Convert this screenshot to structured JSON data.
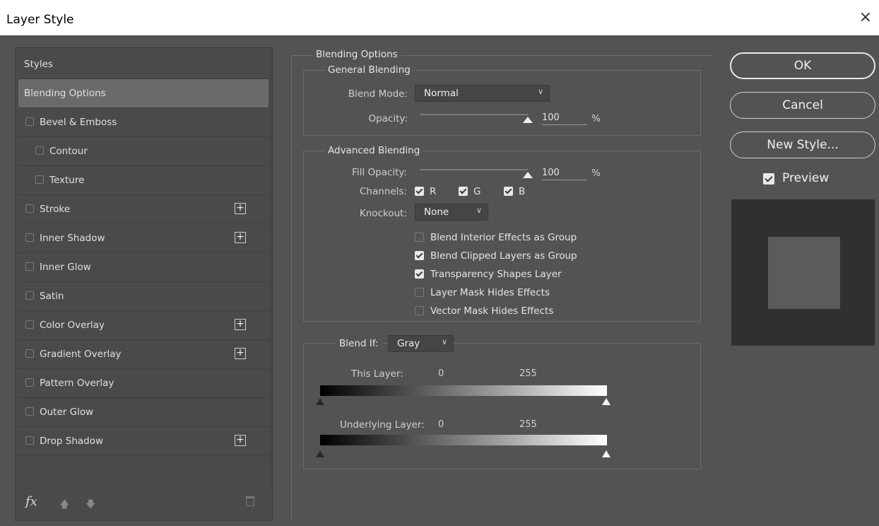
{
  "window": {
    "title": "Layer Style",
    "close_glyph": "×"
  },
  "sidebar": {
    "items": [
      {
        "label": "Styles",
        "checkbox": false,
        "plus": false,
        "selected": false,
        "indent": 0
      },
      {
        "label": "Blending Options",
        "checkbox": false,
        "plus": false,
        "selected": true,
        "indent": 0
      },
      {
        "label": "Bevel & Emboss",
        "checkbox": true,
        "checked": false,
        "plus": false,
        "selected": false,
        "indent": 0
      },
      {
        "label": "Contour",
        "checkbox": true,
        "checked": false,
        "plus": false,
        "selected": false,
        "indent": 1
      },
      {
        "label": "Texture",
        "checkbox": true,
        "checked": false,
        "plus": false,
        "selected": false,
        "indent": 1
      },
      {
        "label": "Stroke",
        "checkbox": true,
        "checked": false,
        "plus": true,
        "selected": false,
        "indent": 0
      },
      {
        "label": "Inner Shadow",
        "checkbox": true,
        "checked": false,
        "plus": true,
        "selected": false,
        "indent": 0
      },
      {
        "label": "Inner Glow",
        "checkbox": true,
        "checked": false,
        "plus": false,
        "selected": false,
        "indent": 0
      },
      {
        "label": "Satin",
        "checkbox": true,
        "checked": false,
        "plus": false,
        "selected": false,
        "indent": 0
      },
      {
        "label": "Color Overlay",
        "checkbox": true,
        "checked": false,
        "plus": true,
        "selected": false,
        "indent": 0
      },
      {
        "label": "Gradient Overlay",
        "checkbox": true,
        "checked": false,
        "plus": true,
        "selected": false,
        "indent": 0
      },
      {
        "label": "Pattern Overlay",
        "checkbox": true,
        "checked": false,
        "plus": false,
        "selected": false,
        "indent": 0
      },
      {
        "label": "Outer Glow",
        "checkbox": true,
        "checked": false,
        "plus": false,
        "selected": false,
        "indent": 0
      },
      {
        "label": "Drop Shadow",
        "checkbox": true,
        "checked": false,
        "plus": true,
        "selected": false,
        "indent": 0
      }
    ],
    "footer": {
      "fx_label": "fx",
      "up_glyph": "🡅",
      "down_glyph": "🡇",
      "trash_icon": "trash-icon"
    }
  },
  "blending": {
    "section_title": "Blending Options",
    "general": {
      "title": "General Blending",
      "blend_mode_label": "Blend Mode:",
      "blend_mode_value": "Normal",
      "opacity_label": "Opacity:",
      "opacity_value": "100",
      "opacity_level": 1.0,
      "percent": "%"
    },
    "advanced": {
      "title": "Advanced Blending",
      "fill_opacity_label": "Fill Opacity:",
      "fill_opacity_value": "100",
      "fill_opacity_level": 1.0,
      "percent": "%",
      "channels_label": "Channels:",
      "channels": [
        {
          "label": "R",
          "checked": true
        },
        {
          "label": "G",
          "checked": true
        },
        {
          "label": "B",
          "checked": true
        }
      ],
      "knockout_label": "Knockout:",
      "knockout_value": "None",
      "options": [
        {
          "label": "Blend Interior Effects as Group",
          "checked": false
        },
        {
          "label": "Blend Clipped Layers as Group",
          "checked": true
        },
        {
          "label": "Transparency Shapes Layer",
          "checked": true
        },
        {
          "label": "Layer Mask Hides Effects",
          "checked": false
        },
        {
          "label": "Vector Mask Hides Effects",
          "checked": false
        }
      ]
    },
    "blend_if": {
      "label": "Blend If:",
      "value": "Gray",
      "this_layer": {
        "label": "This Layer:",
        "low": "0",
        "high": "255"
      },
      "underlying_layer": {
        "label": "Underlying Layer:",
        "low": "0",
        "high": "255"
      }
    }
  },
  "buttons": {
    "ok": "OK",
    "cancel": "Cancel",
    "new_style": "New Style...",
    "preview_label": "Preview",
    "preview_checked": true
  },
  "colors": {
    "dialog_bg": "#535353",
    "selected_item": "#6a6a6a",
    "preview_bg": "#303030",
    "preview_swatch": "#5b5b5b"
  }
}
